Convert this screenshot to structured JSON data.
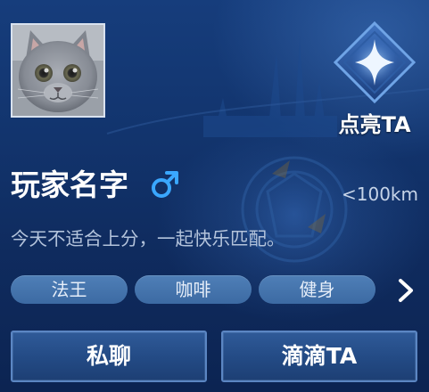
{
  "profile": {
    "player_name": "玩家名字",
    "gender_icon": "male-symbol-icon",
    "distance": "<100km",
    "status_text": "今天不适合上分，一起快乐匹配。"
  },
  "light_up": {
    "label": "点亮TA",
    "icon": "four-point-star-icon"
  },
  "tags": [
    "法王",
    "咖啡",
    "健身"
  ],
  "more_icon": "chevron-right-icon",
  "buttons": {
    "chat": "私聊",
    "ping": "滴滴TA"
  },
  "colors": {
    "background_top": "#163d7c",
    "background_bottom": "#0c2452",
    "gender_blue": "#3aa7ff",
    "tag_fill": "#4f7fb7",
    "button_border": "#5b86c3"
  }
}
